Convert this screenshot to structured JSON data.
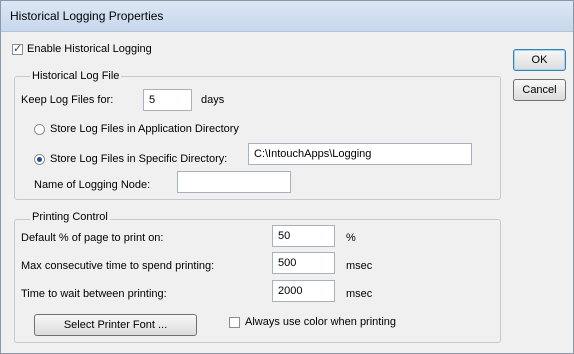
{
  "window": {
    "title": "Historical Logging Properties"
  },
  "enable_logging": {
    "label": "Enable Historical Logging",
    "checked": true
  },
  "buttons": {
    "ok": "OK",
    "cancel": "Cancel",
    "select_font": "Select Printer Font ..."
  },
  "log_file": {
    "legend": "Historical Log File",
    "keep_label": "Keep Log Files for:",
    "keep_value": "5",
    "keep_unit": "days",
    "store_app_label": "Store Log Files in Application Directory",
    "store_app_selected": false,
    "store_specific_label": "Store Log Files in Specific Directory:",
    "store_specific_selected": true,
    "directory_value": "C:\\IntouchApps\\Logging",
    "node_label": "Name of Logging Node:",
    "node_value": ""
  },
  "printing": {
    "legend": "Printing Control",
    "rows": [
      {
        "label": "Default % of page to print on:",
        "value": "50",
        "unit": "%"
      },
      {
        "label": "Max consecutive time to spend printing:",
        "value": "500",
        "unit": "msec"
      },
      {
        "label": "Time to wait between printing:",
        "value": "2000",
        "unit": "msec"
      }
    ],
    "always_color_label": "Always use color when printing",
    "always_color_checked": false
  }
}
